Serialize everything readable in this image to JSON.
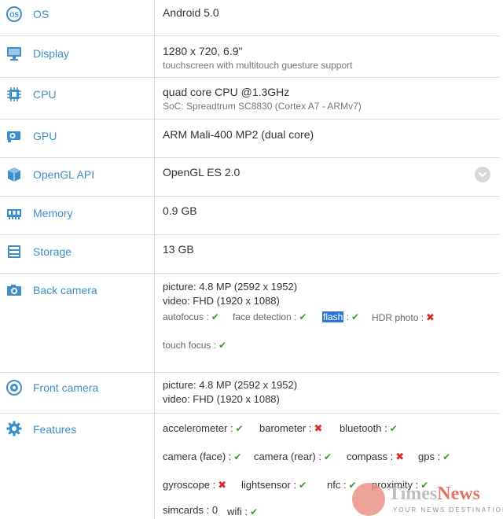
{
  "rows": {
    "os": {
      "label": "OS",
      "value": "Android 5.0"
    },
    "display": {
      "label": "Display",
      "value": "1280 x 720, 6.9\"",
      "sub": "touchscreen with multitouch guesture support"
    },
    "cpu": {
      "label": "CPU",
      "value": "quad core CPU @1.3GHz",
      "sub": "SoC: Spreadtrum SC8830 (Cortex A7 - ARMv7)"
    },
    "gpu": {
      "label": "GPU",
      "value": "ARM Mali-400 MP2 (dual core)"
    },
    "opengl": {
      "label": "OpenGL API",
      "value": "OpenGL ES 2.0"
    },
    "memory": {
      "label": "Memory",
      "value": "0.9 GB"
    },
    "storage": {
      "label": "Storage",
      "value": "13 GB"
    },
    "back_camera": {
      "label": "Back camera",
      "picture": "picture: 4.8 MP (2592 x 1952)",
      "video": "video: FHD (1920 x 1088)",
      "autofocus": "autofocus :",
      "face_detection": "face detection :",
      "flash": "flash",
      "flash_colon": " :",
      "hdr_photo": "HDR photo :",
      "touch_focus": "touch focus :"
    },
    "front_camera": {
      "label": "Front camera",
      "picture": "picture: 4.8 MP (2592 x 1952)",
      "video": "video: FHD (1920 x 1088)"
    },
    "features": {
      "label": "Features",
      "accelerometer": "accelerometer :",
      "barometer": "barometer :",
      "bluetooth": "bluetooth :",
      "camera_face": "camera (face) :",
      "camera_rear": "camera (rear) :",
      "compass": "compass :",
      "gps": "gps :",
      "gyroscope": "gyroscope :",
      "lightsensor": "lightsensor :",
      "nfc": "nfc :",
      "proximity": "proximity :",
      "simcards": "simcards : 0",
      "wifi": "wifi :"
    }
  },
  "marks": {
    "yes": "✔",
    "no": "✖"
  },
  "watermark": {
    "title_left": "Times",
    "title_right": "News",
    "tagline": "YOUR NEWS DESTINATION"
  },
  "colors": {
    "accent": "#3d8fc9",
    "yes": "#3c9a2d",
    "no": "#d42a24",
    "highlight": "#2f74d0"
  }
}
